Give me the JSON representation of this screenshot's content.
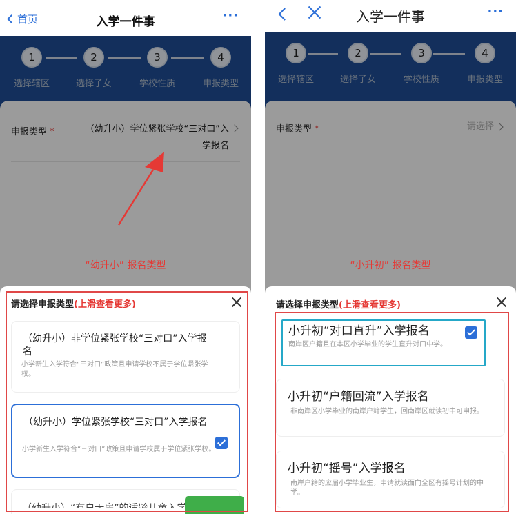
{
  "left": {
    "nav": {
      "back_label": "首页",
      "title": "入学一件事",
      "more": "···"
    },
    "steps": [
      {
        "num": "1",
        "label": "选择辖区"
      },
      {
        "num": "2",
        "label": "选择子女"
      },
      {
        "num": "3",
        "label": "学校性质"
      },
      {
        "num": "4",
        "label": "申报类型"
      }
    ],
    "form": {
      "label": "申报类型",
      "required_mark": "*",
      "value": "（幼升小）学位紧张学校“三对口”入学报名"
    },
    "annotation": "“幼升小” 报名类型",
    "sheet": {
      "title": "请选择申报类型",
      "hint": "(上滑查看更多)",
      "options": [
        {
          "title": "（幼升小）非学位紧张学校“三对口”入学报名",
          "desc": "小学新生入学符合“三对口”政策且申请学校不属于学位紧张学校。",
          "selected": false
        },
        {
          "title": "（幼升小）学位紧张学校“三对口”入学报名",
          "desc": "小学新生入学符合“三对口”政策且申请学校属于学位紧张学校。",
          "selected": true
        }
      ],
      "clipped_text": "（幼升小）“有户无房”的适龄儿童入学报名"
    }
  },
  "right": {
    "nav": {
      "title": "入学一件事",
      "more": "···"
    },
    "steps": [
      {
        "num": "1",
        "label": "选择辖区"
      },
      {
        "num": "2",
        "label": "选择子女"
      },
      {
        "num": "3",
        "label": "学校性质"
      },
      {
        "num": "4",
        "label": "申报类型"
      }
    ],
    "form": {
      "label": "申报类型",
      "required_mark": "*",
      "placeholder": "请选择"
    },
    "annotation": "“小升初” 报名类型",
    "sheet": {
      "title": "请选择申报类型",
      "hint": "(上滑查看更多)",
      "options": [
        {
          "title": "小升初“对口直升”入学报名",
          "desc": "南岸区户籍且在本区小学毕业的学生直升对口中学。",
          "selected": true
        },
        {
          "title": "小升初“户籍回流”入学报名",
          "desc": "非南岸区小学毕业的南岸户籍学生，回南岸区就读初中可申报。",
          "selected": false
        },
        {
          "title": "小升初“摇号”入学报名",
          "desc": "南岸户籍的应届小学毕业生，申请就读面向全区有摇号计划的中学。",
          "selected": false
        }
      ]
    }
  },
  "colors": {
    "accent": "#2c6fd8",
    "stepper_bg": "#1f4d95",
    "annotation_red": "#e53935",
    "frame_red": "#e04848",
    "highlight_cyan": "#25a8c8",
    "button_green": "#3fae49"
  }
}
